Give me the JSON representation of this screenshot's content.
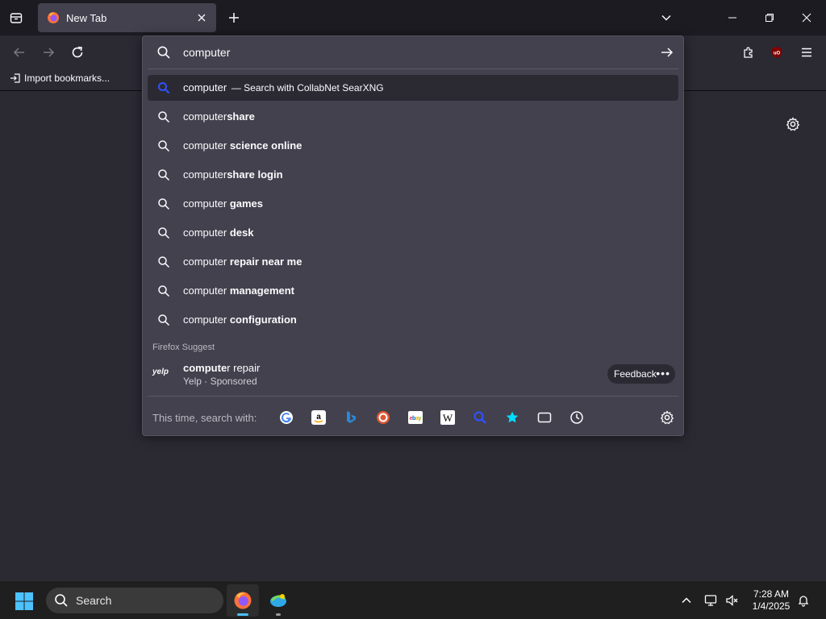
{
  "tabs": [
    {
      "title": "New Tab"
    }
  ],
  "bookmarks_toolbar": {
    "import_label": "Import bookmarks..."
  },
  "urlbar": {
    "input_value": "computer",
    "heuristic": {
      "text": "computer",
      "action": "— Search with CollabNet SearXNG"
    },
    "suggestions": [
      {
        "typed": "compute",
        "rest_normal": "r",
        "rest_bold": "share",
        "plain": "computer",
        "bold": "share"
      },
      {
        "plain": "computer",
        "bold": " science online"
      },
      {
        "plain": "computer",
        "bold": "share login"
      },
      {
        "plain": "computer",
        "bold": " games"
      },
      {
        "plain": "computer",
        "bold": " desk"
      },
      {
        "plain": "computer",
        "bold": " repair near me"
      },
      {
        "plain": "computer",
        "bold": " management"
      },
      {
        "plain": "computer",
        "bold": " configuration"
      }
    ],
    "suggest_label": "Firefox Suggest",
    "sponsored": {
      "logo": "yelp",
      "title_bold": "compute",
      "title_rest": "r repair",
      "subtitle": "Yelp · Sponsored",
      "feedback_label": "Feedback"
    },
    "oneoff_label": "This time, search with:",
    "oneoff_engines": [
      "google-icon",
      "amazon-icon",
      "bing-icon",
      "duckduckgo-icon",
      "ebay-icon",
      "wikipedia-icon",
      "searxng-icon",
      "bookmarks-icon",
      "tabs-icon",
      "history-icon"
    ]
  },
  "taskbar": {
    "search_label": "Search",
    "time": "7:28 AM",
    "date": "1/4/2025"
  },
  "colors": {
    "background": "#2b2a33",
    "panel": "#42414d",
    "tabstrip": "#1c1b22",
    "accent": "#4cc2ff"
  }
}
